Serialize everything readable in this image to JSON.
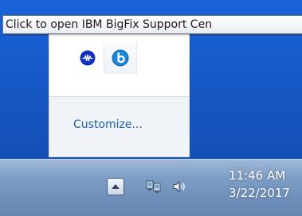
{
  "tooltip": {
    "text": "Click to open IBM BigFix Support Cen"
  },
  "overflow_flyout": {
    "icons": [
      "bigfix-support-center-icon",
      "blue-b-icon"
    ],
    "customize_label": "Customize..."
  },
  "taskbar": {
    "tray_icons": [
      "show-hidden-icons-arrow",
      "network-icon",
      "volume-icon"
    ],
    "clock": {
      "time": "11:46 AM",
      "date": "3/22/2017"
    }
  },
  "colors": {
    "desktop": "#1a63d8",
    "tooltip_bg": "#ffffff",
    "link": "#1a5fb4",
    "taskbar": "#7f9ec6",
    "bigfix_icon": "#0f2fbf",
    "b_icon": "#1e88d8"
  }
}
